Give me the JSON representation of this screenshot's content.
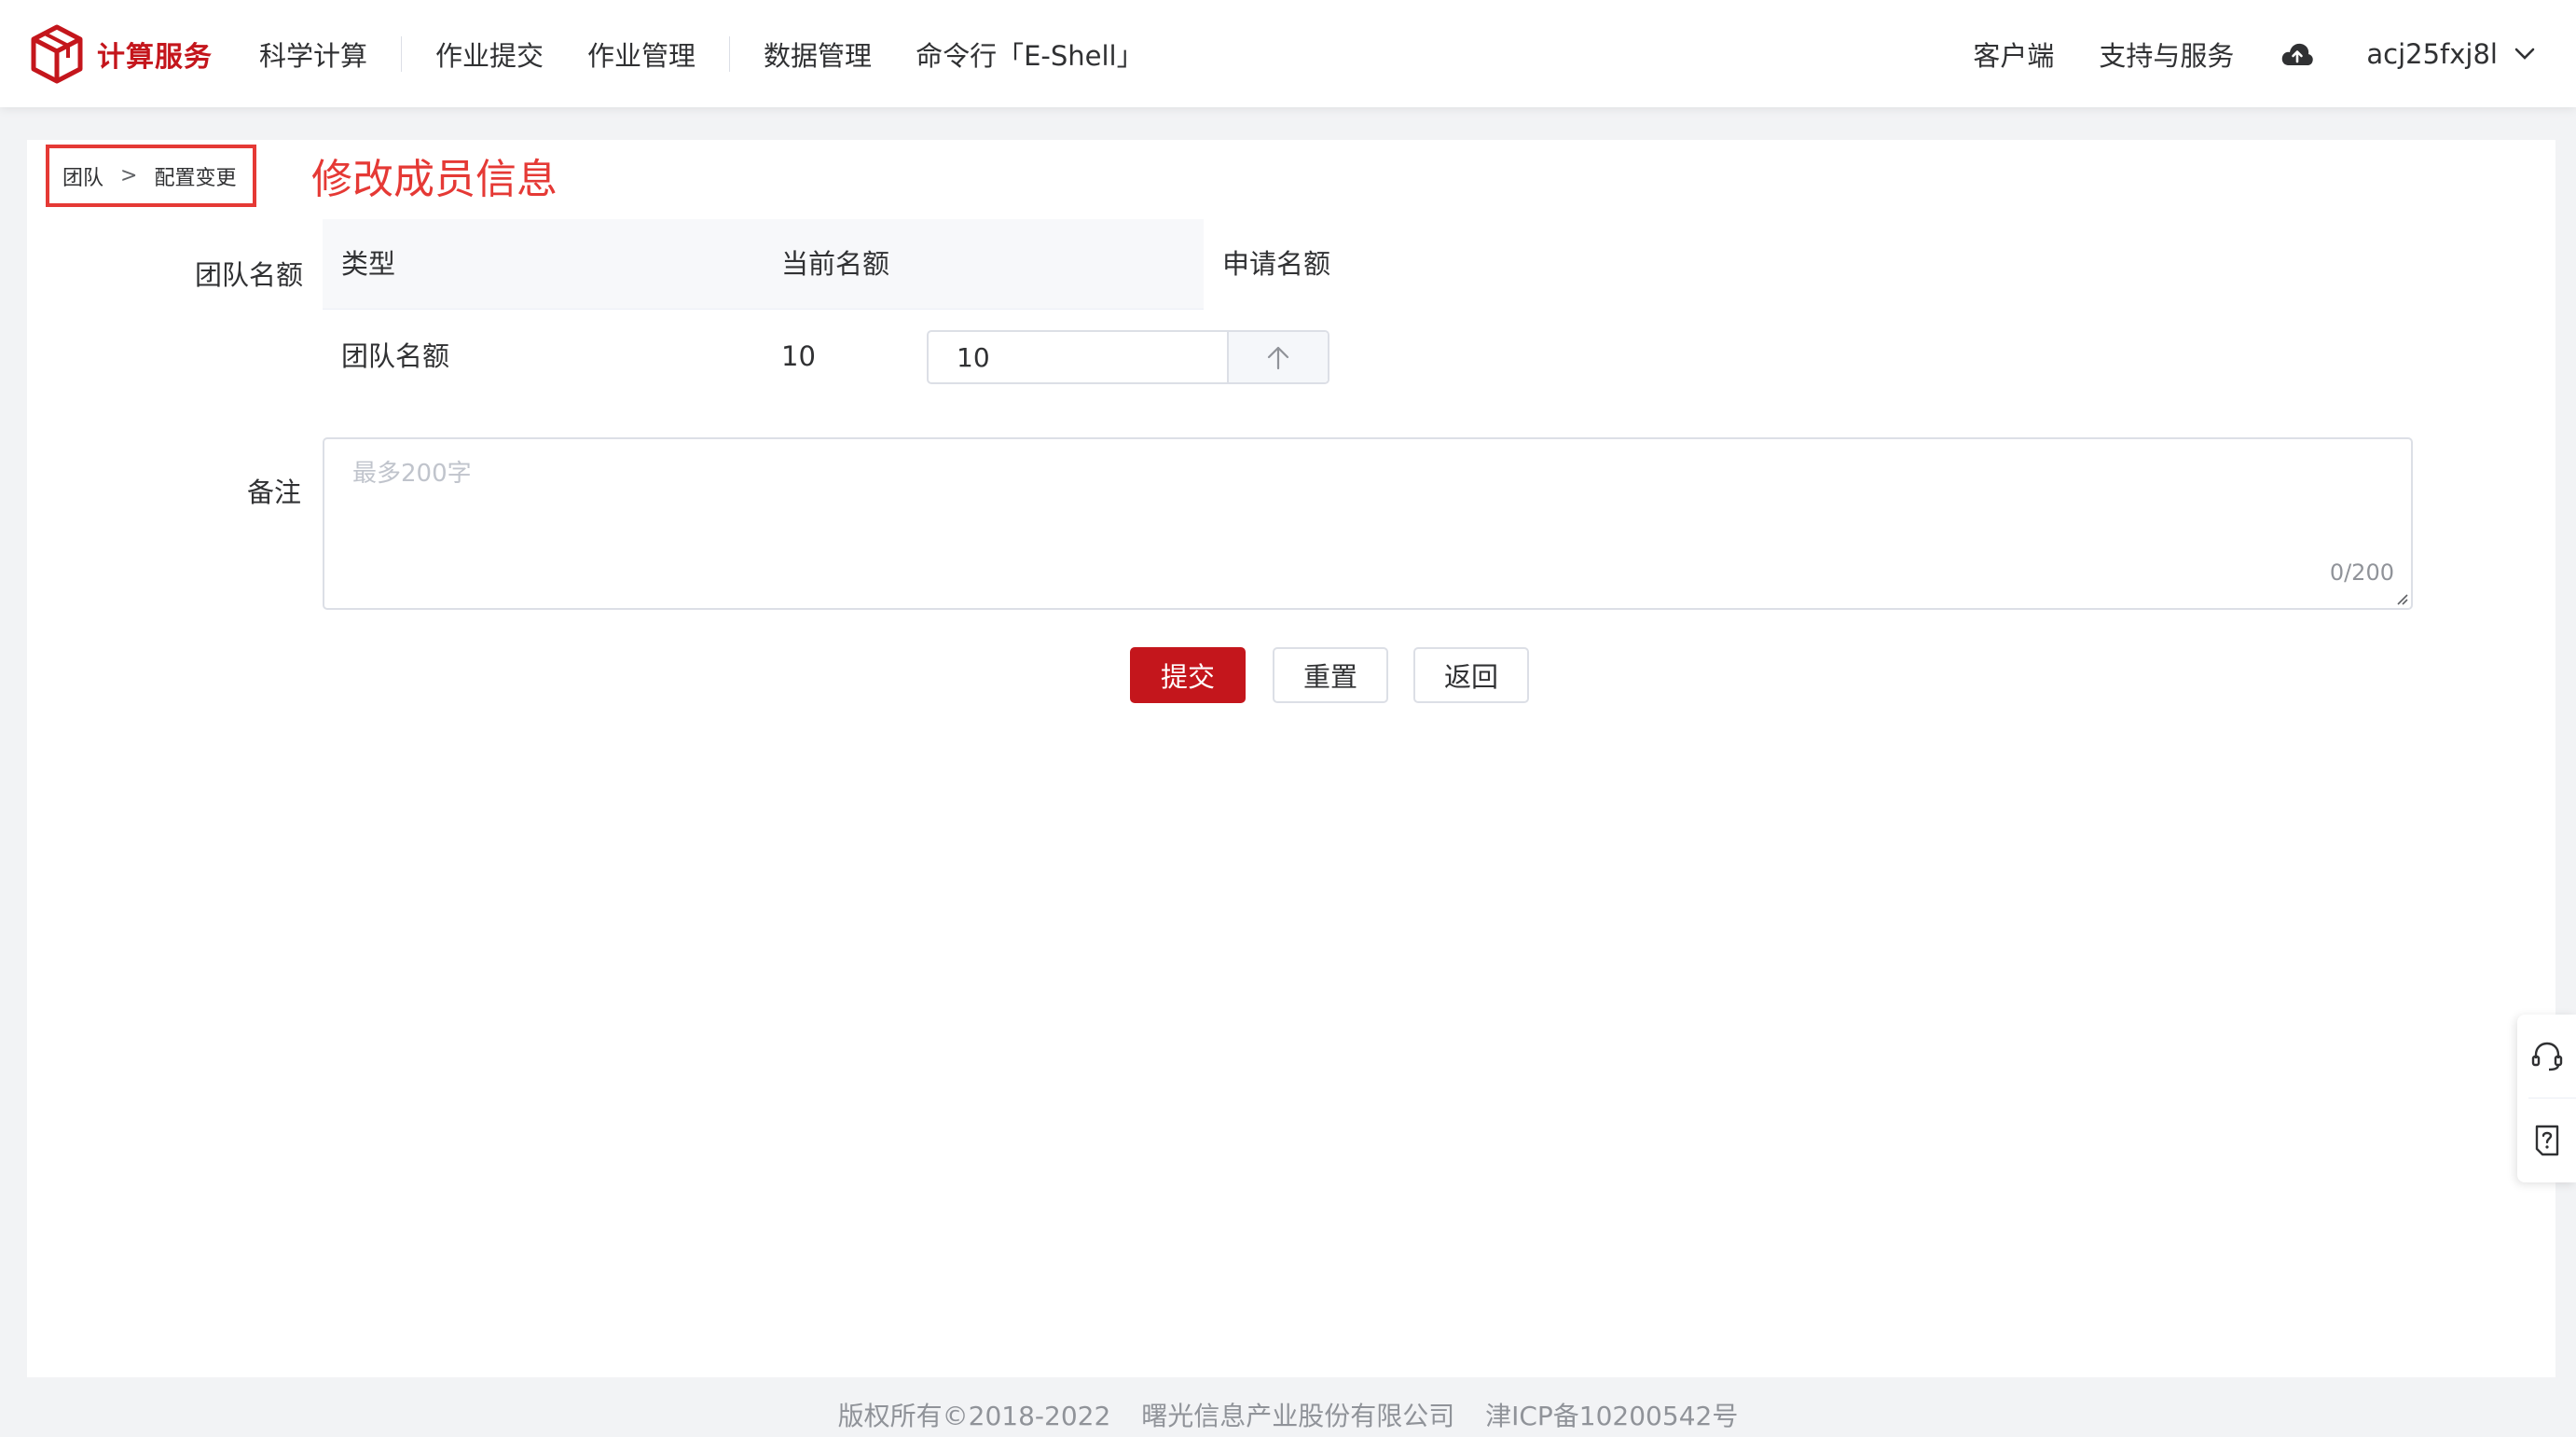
{
  "brand": {
    "name": "计算服务",
    "color": "#c4161c"
  },
  "nav": {
    "items": [
      "科学计算",
      "作业提交",
      "作业管理",
      "数据管理",
      "命令行「E-Shell」"
    ]
  },
  "header_right": {
    "client": "客户端",
    "support": "支持与服务",
    "cloud_icon": "cloud-upload-icon",
    "username": "acj25fxj8l"
  },
  "breadcrumb": {
    "root": "团队",
    "current": "配置变更"
  },
  "page_title": "修改成员信息",
  "form": {
    "quota_label": "团队名额",
    "quota_table": {
      "headers": [
        "类型",
        "当前名额",
        "申请名额"
      ],
      "rows": [
        {
          "type": "团队名额",
          "current": "10",
          "requested": "10"
        }
      ]
    },
    "remark_label": "备注",
    "remark_placeholder": "最多200字",
    "remark_counter": "0/200"
  },
  "buttons": {
    "submit": "提交",
    "reset": "重置",
    "back": "返回"
  },
  "float_tools": [
    "headset-icon",
    "help-doc-icon"
  ],
  "footer": {
    "copyright": "版权所有©2018-2022",
    "company": "曙光信息产业股份有限公司",
    "icp": "津ICP备10200542号"
  },
  "colors": {
    "accent": "#c4161c",
    "annotation": "#e53935"
  }
}
